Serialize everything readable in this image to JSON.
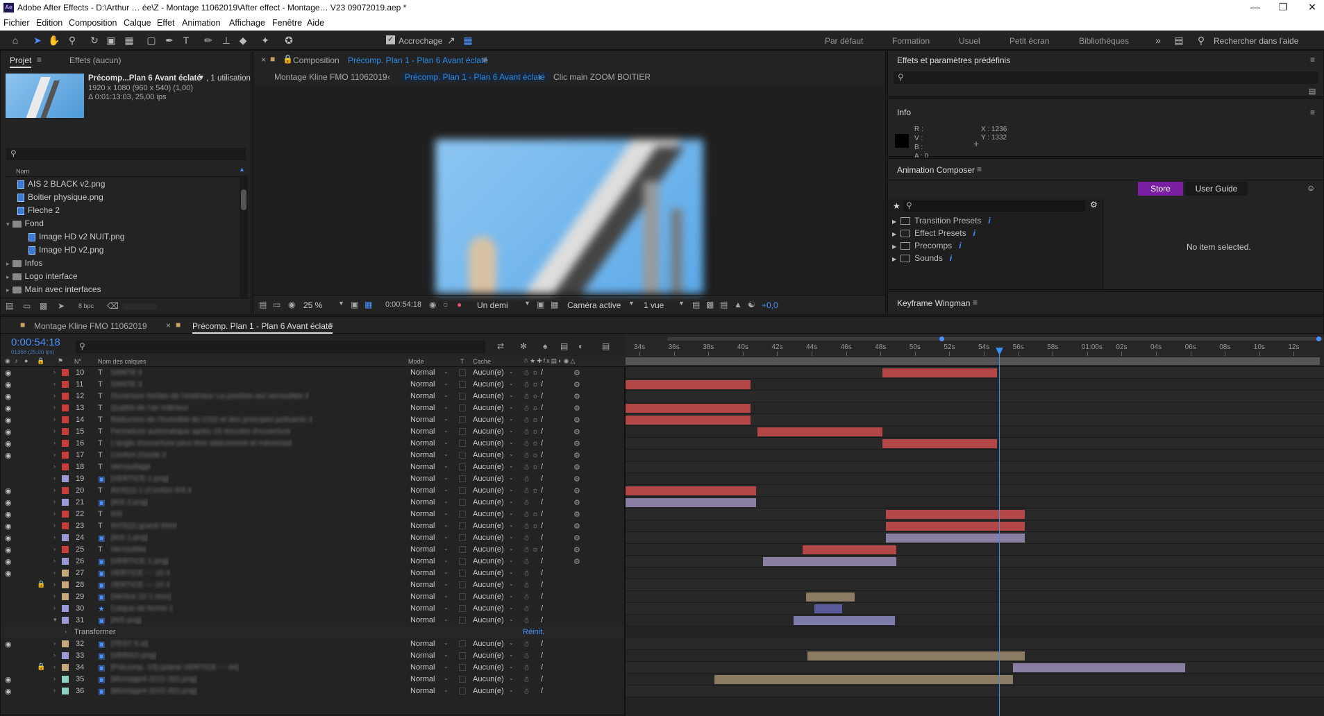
{
  "titlebar": {
    "app": "Adobe After Effects",
    "path": "D:\\Arthur … ée\\Z - Montage 11062019\\After effect - Montage… V23 09072019.aep *",
    "logo": "Ae"
  },
  "menu": [
    "Fichier",
    "Edition",
    "Composition",
    "Calque",
    "Effet",
    "Animation",
    "Affichage",
    "Fenêtre",
    "Aide"
  ],
  "toolbar": {
    "snap_label": "Accrochage"
  },
  "workspaces": [
    "Par défaut",
    "Formation",
    "Usuel",
    "Petit écran",
    "Bibliothèques"
  ],
  "search_help": "Rechercher dans l'aide",
  "project": {
    "tab": "Projet",
    "effects_tab": "Effets (aucun)",
    "asset_name": "Précomp...Plan 6 Avant éclaté",
    "usage": ", 1 utilisation",
    "dims": "1920 x 1080  (960 x 540) (1,00)",
    "duration": "Δ 0:01:13:03, 25,00 ips",
    "col_name": "Nom",
    "items": [
      {
        "name": "AIS 2 BLACK v2.png",
        "type": "file",
        "indent": 1
      },
      {
        "name": "Boitier physique.png",
        "type": "file",
        "indent": 1
      },
      {
        "name": "Fleche 2",
        "type": "file",
        "indent": 1
      },
      {
        "name": "Fond",
        "type": "folder",
        "indent": 0
      },
      {
        "name": "Image HD v2 NUIT.png",
        "type": "file",
        "indent": 2
      },
      {
        "name": "Image HD v2.png",
        "type": "file",
        "indent": 2
      },
      {
        "name": "Infos",
        "type": "folder",
        "indent": 0
      },
      {
        "name": "Logo interface",
        "type": "folder",
        "indent": 0
      },
      {
        "name": "Main avec interfaces",
        "type": "folder",
        "indent": 0
      }
    ],
    "bpc": "8 bpc"
  },
  "composition": {
    "tab_prefix": "Composition",
    "tab_name": "Précomp. Plan 1 - Plan 6 Avant éclaté",
    "breadcrumbs": [
      "Montage Kline FMO 11062019",
      "Précomp. Plan 1 - Plan 6 Avant éclaté",
      "Clic main ZOOM BOITIER"
    ],
    "zoom": "25 %",
    "time": "0:00:54:18",
    "resolution": "Un demi",
    "camera": "Caméra active",
    "views": "1 vue",
    "exposure": "+0,0"
  },
  "effects_panel": {
    "title": "Effets et paramètres prédéfinis"
  },
  "info": {
    "title": "Info",
    "r": "R :",
    "v": "V :",
    "b": "B :",
    "a": "A : 0",
    "x": "X : 1236",
    "y": "Y : 1332"
  },
  "animation_composer": {
    "title": "Animation Composer",
    "store": "Store",
    "guide": "User Guide",
    "items": [
      "Transition Presets",
      "Effect Presets",
      "Precomps",
      "Sounds"
    ],
    "empty": "No item selected.",
    "accent": "#7b1fa2"
  },
  "keyframe_wingman": "Keyframe Wingman",
  "timeline": {
    "tabs": [
      "Montage Kline FMO 11062019",
      "Précomp. Plan 1 - Plan 6 Avant éclaté"
    ],
    "timecode": "0:00:54:18",
    "frames": "01368 (25,00 ips)",
    "cols": {
      "num": "N°",
      "name": "Nom des calques",
      "mode": "Mode",
      "t": "T",
      "cache": "Cache"
    },
    "ruler": [
      "34s",
      "36s",
      "38s",
      "40s",
      "42s",
      "44s",
      "46s",
      "48s",
      "50s",
      "52s",
      "54s",
      "56s",
      "58s",
      "01:00s",
      "02s",
      "04s",
      "06s",
      "08s",
      "10s",
      "12s"
    ],
    "mode": "Normal",
    "cache": "Aucun(e)",
    "transform_label": "Transformer",
    "reset": "Réinit.",
    "layers": [
      {
        "n": "10",
        "type": "T",
        "color": "#c83c3c",
        "name": "SANTE 4"
      },
      {
        "n": "11",
        "type": "T",
        "color": "#c83c3c",
        "name": "SANTE 3"
      },
      {
        "n": "12",
        "type": "T",
        "color": "#c83c3c",
        "name": "Ouverture limitée de l'extérieur La position est verrouillée 3"
      },
      {
        "n": "13",
        "type": "T",
        "color": "#c83c3c",
        "name": "Qualité de l'air intérieur"
      },
      {
        "n": "14",
        "type": "T",
        "color": "#c83c3c",
        "name": "Réduction de l'humidité du CO2 et des principes polluants 3"
      },
      {
        "n": "15",
        "type": "T",
        "color": "#c83c3c",
        "name": "Fermeture automatique après 15 minutes d'ouverture"
      },
      {
        "n": "16",
        "type": "T",
        "color": "#c83c3c",
        "name": "L'angle d'ouverture peut être sélectionné et mémorisé"
      },
      {
        "n": "17",
        "type": "T",
        "color": "#c83c3c",
        "name": "Confort (Oxide 2"
      },
      {
        "n": "18",
        "type": "T",
        "color": "#c83c3c",
        "name": "Verrouillage"
      },
      {
        "n": "19",
        "type": "img",
        "color": "#9a9ad8",
        "name": "[VERTICE 1.png]"
      },
      {
        "n": "20",
        "type": "T",
        "color": "#c83c3c",
        "name": "AVIS(2) 1 (Confort 4/4 4"
      },
      {
        "n": "21",
        "type": "img",
        "color": "#9a9ad8",
        "name": "[AIS 2.png]"
      },
      {
        "n": "22",
        "type": "T",
        "color": "#c83c3c",
        "name": "AIS"
      },
      {
        "n": "23",
        "type": "T",
        "color": "#c83c3c",
        "name": "AVIS(2) grand 4444"
      },
      {
        "n": "24",
        "type": "img",
        "color": "#9a9ad8",
        "name": "[AIS 1.png]"
      },
      {
        "n": "25",
        "type": "T",
        "color": "#c83c3c",
        "name": "Verrouillée"
      },
      {
        "n": "26",
        "type": "img",
        "color": "#9a9ad8",
        "name": "[VERTICE 1.png]"
      },
      {
        "n": "27",
        "type": "img",
        "color": "#c8a87a",
        "name": "VERTICE --- 10 4"
      },
      {
        "n": "28",
        "type": "img",
        "color": "#c8a87a",
        "name": "VERTICE --- 10 3"
      },
      {
        "n": "29",
        "type": "img",
        "color": "#c8a87a",
        "name": "[Vertice 10 1.mov]"
      },
      {
        "n": "30",
        "type": "star",
        "color": "#9a9ad8",
        "name": "Calque de forme 1"
      },
      {
        "n": "31",
        "type": "img",
        "color": "#9a9ad8",
        "name": "[AIS.png]"
      },
      {
        "n": "32",
        "type": "img",
        "color": "#c8a87a",
        "name": "[TEST 5.ai]"
      },
      {
        "n": "33",
        "type": "img",
        "color": "#9a9ad8",
        "name": "[VERSO.png]"
      },
      {
        "n": "34",
        "type": "img",
        "color": "#c8a87a",
        "name": "[Précomp. 15] (plane VERTICE --- 44]"
      },
      {
        "n": "35",
        "type": "img",
        "color": "#8fd0c0",
        "name": "[Montage4-2(V2-3D).png]"
      },
      {
        "n": "36",
        "type": "img",
        "color": "#8fd0c0",
        "name": "[Montage4-2(V2-3D).png]"
      }
    ]
  }
}
